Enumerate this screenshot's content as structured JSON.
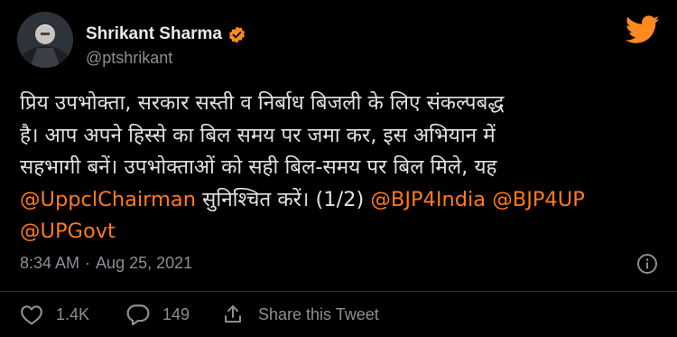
{
  "author": {
    "name": "Shrikant Sharma",
    "handle": "@ptshrikant"
  },
  "tweet": {
    "lines": [
      [
        {
          "text": "प्रिय उपभोक्ता, सरकार सस्ती व निर्बाध बिजली के लिए संकल्पबद्ध",
          "kind": "plain"
        }
      ],
      [
        {
          "text": "है। आप अपने हिस्से का बिल समय पर जमा कर, इस अभियान में",
          "kind": "plain"
        }
      ],
      [
        {
          "text": "सहभागी बनें। उपभोक्ताओं को सही बिल-समय पर बिल मिले, यह",
          "kind": "plain"
        }
      ],
      [
        {
          "text": "@UppclChairman",
          "kind": "mention"
        },
        {
          "text": " सुनिश्चित करें। (1/2) ",
          "kind": "plain"
        },
        {
          "text": "@BJP4India",
          "kind": "mention"
        },
        {
          "text": " ",
          "kind": "plain"
        },
        {
          "text": "@BJP4UP",
          "kind": "mention"
        }
      ],
      [
        {
          "text": "@UPGovt",
          "kind": "mention"
        }
      ]
    ]
  },
  "meta": {
    "time": "8:34 AM",
    "separator": "·",
    "date": "Aug 25, 2021"
  },
  "actions": {
    "like_count": "1.4K",
    "reply_count": "149",
    "share_label": "Share this Tweet"
  },
  "icons": {
    "verified": "verified-badge-icon",
    "twitter": "twitter-bird-icon",
    "info": "info-icon",
    "like": "heart-icon",
    "reply": "reply-bubble-icon",
    "share": "share-icon"
  },
  "colors": {
    "background": "#000000",
    "mention": "#ff7a1a",
    "accent": "#ff8a1f",
    "muted": "#8b8f94",
    "text": "#e0e0e0"
  }
}
